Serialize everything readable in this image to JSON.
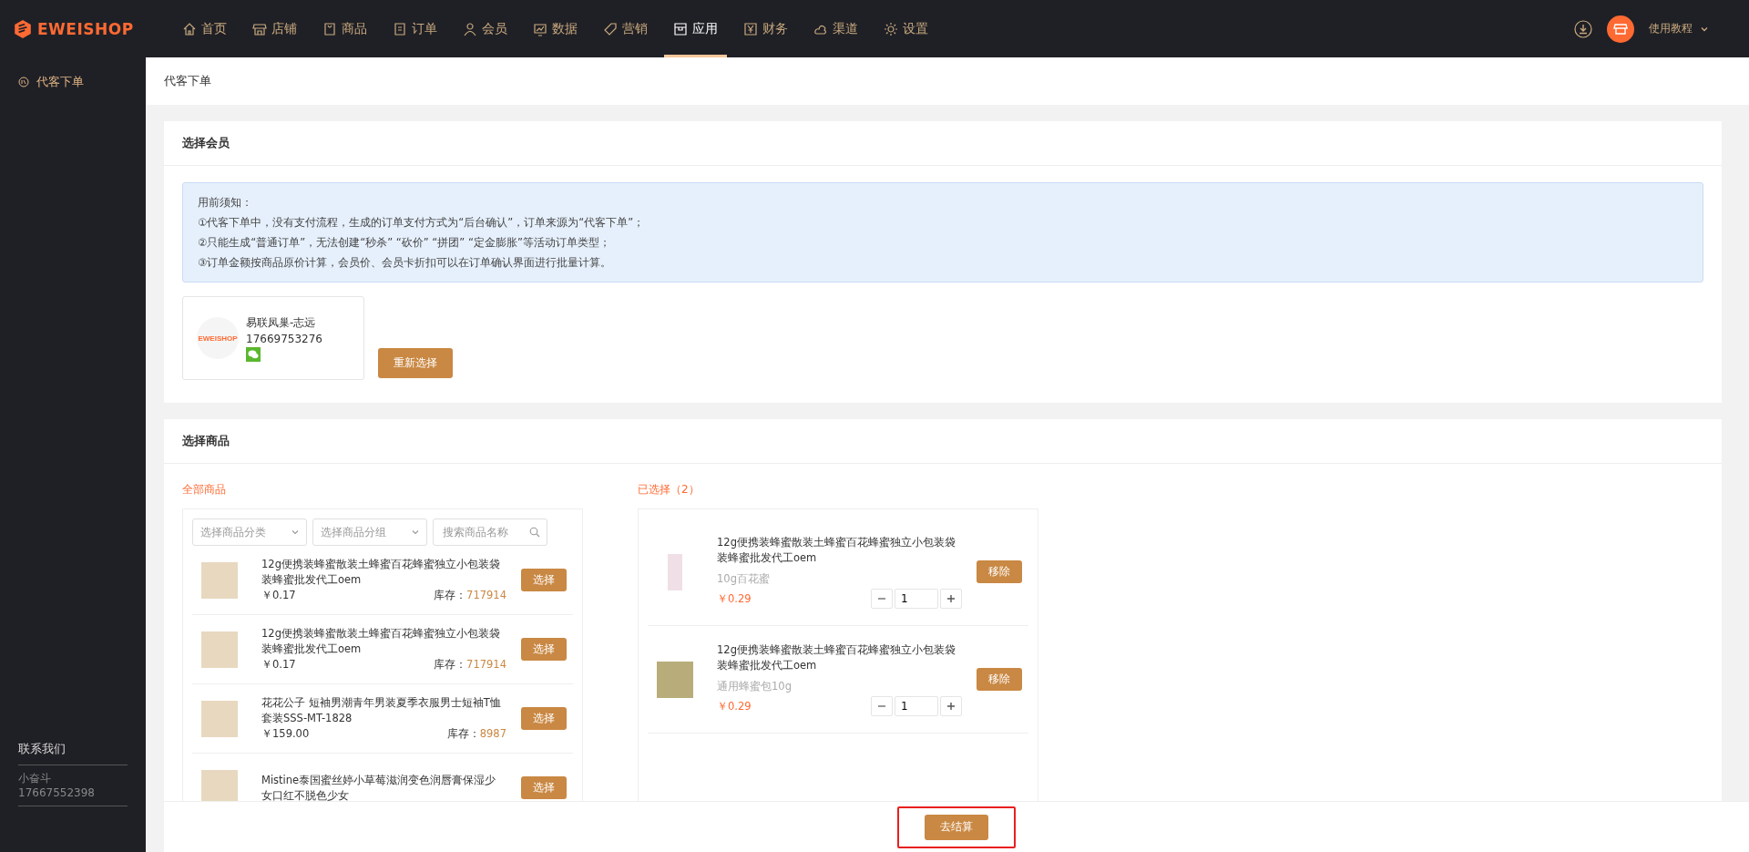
{
  "brand": "EWEISHOP",
  "nav": [
    {
      "label": "首页",
      "selected": false
    },
    {
      "label": "店铺",
      "selected": false
    },
    {
      "label": "商品",
      "selected": false
    },
    {
      "label": "订单",
      "selected": false
    },
    {
      "label": "会员",
      "selected": false
    },
    {
      "label": "数据",
      "selected": false
    },
    {
      "label": "营销",
      "selected": false
    },
    {
      "label": "应用",
      "selected": true
    },
    {
      "label": "财务",
      "selected": false
    },
    {
      "label": "渠道",
      "selected": false
    },
    {
      "label": "设置",
      "selected": false
    }
  ],
  "help_menu": "使用教程",
  "sidebar": {
    "items": [
      {
        "label": "代客下单",
        "selected": true
      }
    ],
    "contact": {
      "title": "联系我们",
      "name": "小奋斗",
      "phone": "17667552398"
    }
  },
  "page_title": "代客下单",
  "member_section": {
    "title": "选择会员",
    "notice": [
      "用前须知：",
      "①代客下单中，没有支付流程，生成的订单支付方式为“后台确认”，订单来源为“代客下单”；",
      "②只能生成“普通订单”，无法创建“秒杀” “砍价” “拼团” “定金膨胀”等活动订单类型；",
      "③订单金额按商品原价计算，会员价、会员卡折扣可以在订单确认界面进行批量计算。"
    ],
    "member": {
      "logo_text": "EWEISHOP",
      "name": "易联凤巢-志远",
      "phone": "17669753276"
    },
    "reselect_button": "重新选择"
  },
  "goods_section": {
    "title": "选择商品",
    "all_label": "全部商品",
    "filters": [
      {
        "kind": "select",
        "placeholder": "选择商品分类"
      },
      {
        "kind": "select",
        "placeholder": "选择商品分组"
      },
      {
        "kind": "search",
        "placeholder": "搜索商品名称"
      }
    ],
    "products": [
      {
        "name": "12g便携装蜂蜜散装土蜂蜜百花蜂蜜独立小包装袋装蜂蜜批发代工oem",
        "price": "￥0.17",
        "stock_label": "库存：",
        "stock": "717914",
        "button": "选择"
      },
      {
        "name": "12g便携装蜂蜜散装土蜂蜜百花蜂蜜独立小包装袋装蜂蜜批发代工oem",
        "price": "￥0.17",
        "stock_label": "库存：",
        "stock": "717914",
        "button": "选择"
      },
      {
        "name": "花花公子 短袖男潮青年男装夏季衣服男士短袖T恤套装SSS-MT-1828",
        "price": "￥159.00",
        "stock_label": "库存：",
        "stock": "8987",
        "button": "选择"
      },
      {
        "name": "Mistine泰国蜜丝婷小草莓滋润变色润唇膏保湿少女口红不脱色少女",
        "button": "选择"
      }
    ],
    "selected_label": "已选择（2）",
    "selected": [
      {
        "name": "12g便携装蜂蜜散装土蜂蜜百花蜂蜜独立小包装袋装蜂蜜批发代工oem",
        "spec": "10g百花蜜",
        "price": "￥0.29",
        "quantity": "1",
        "button": "移除"
      },
      {
        "name": "12g便携装蜂蜜散装土蜂蜜百花蜂蜜独立小包装袋装蜂蜜批发代工oem",
        "spec": "通用蜂蜜包10g",
        "price": "￥0.29",
        "quantity": "1",
        "button": "移除"
      }
    ]
  },
  "checkout_button": "去结算"
}
